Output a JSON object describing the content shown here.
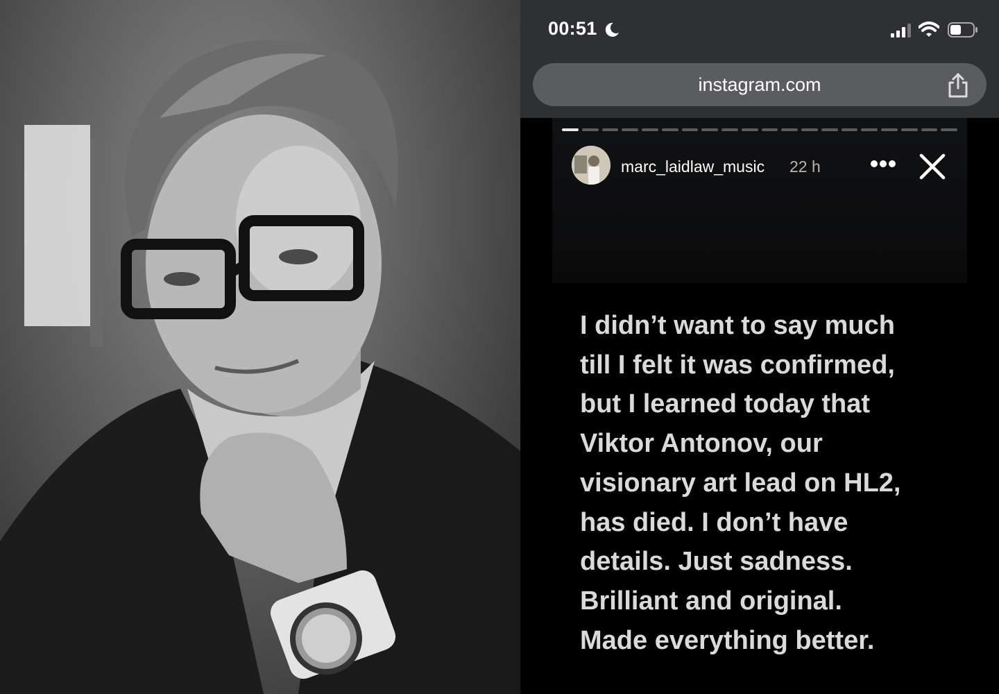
{
  "status_bar": {
    "time": "00:51",
    "moon_icon": "moon-icon",
    "signal_icon": "cellular-signal-icon",
    "wifi_icon": "wifi-icon",
    "battery_icon": "battery-icon"
  },
  "browser": {
    "url": "instagram.com",
    "share_icon": "share-icon"
  },
  "story": {
    "username": "marc_laidlaw_music",
    "age": "22 h",
    "more_icon": "more-options-icon",
    "close_icon": "close-icon",
    "segment_count": 20,
    "active_segment": 1,
    "lines": [
      "I didn’t want to say much",
      "till I felt it was confirmed,",
      "but I learned today that",
      "Viktor Antonov, our",
      "visionary art lead on HL2,",
      "has died. I don’t have",
      "details. Just sadness.",
      "Brilliant and original.",
      "Made everything better."
    ]
  },
  "colors": {
    "browser_chrome": "#2e3033",
    "url_bar": "#5a5c5f",
    "story_text": "#dadada"
  }
}
